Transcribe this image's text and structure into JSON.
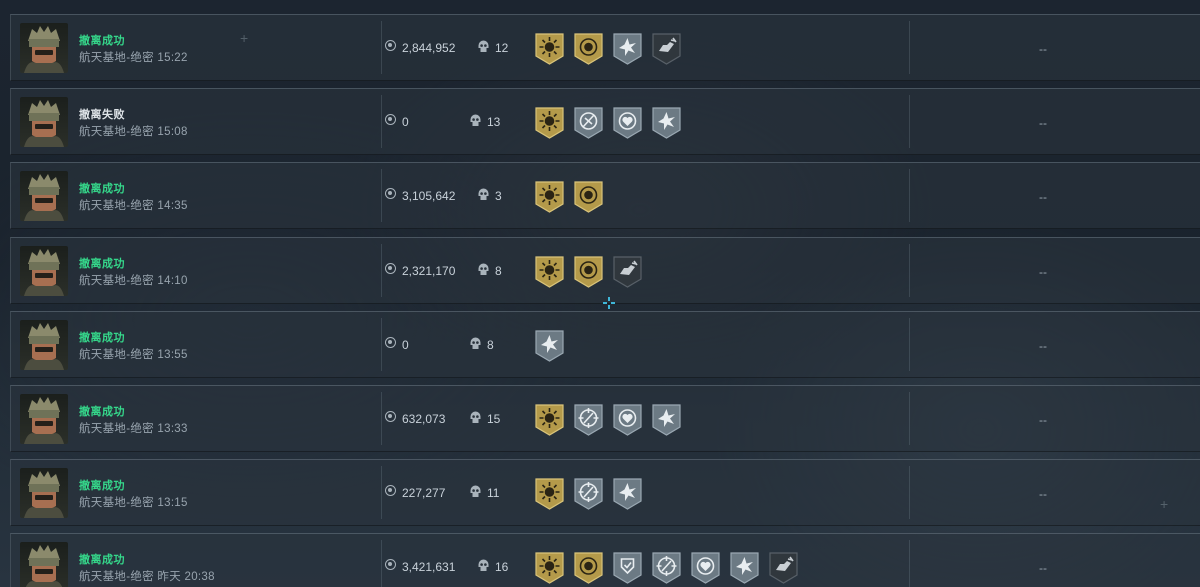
{
  "colors": {
    "success": "#35d88b",
    "fail": "#dfe4e8",
    "gold_badge": "#b49a4a",
    "silver_badge": "#6c7a84",
    "dark_badge": "#30373d"
  },
  "icons": {
    "currency": "coin-icon",
    "kills": "skull-icon",
    "badges": {
      "gold-sun": "sun-burst-gold-badge-icon",
      "gold-target": "target-circle-gold-badge-icon",
      "silver-star": "star-burst-silver-badge-icon",
      "silver-compass": "compass-circle-silver-badge-icon",
      "silver-crosshair": "crosshair-circle-silver-badge-icon",
      "silver-heart": "medic-circle-silver-badge-icon",
      "dark-hand": "hand-grab-dark-badge-icon",
      "silver-shield": "shield-check-silver-badge-icon"
    }
  },
  "matches": [
    {
      "status": "撤离成功",
      "result": "success",
      "map_time": "航天基地-绝密 15:22",
      "value": "2,844,952",
      "kills": "12",
      "badges": [
        "gold-sun",
        "gold-target",
        "silver-star",
        "dark-hand"
      ],
      "extra": "--"
    },
    {
      "status": "撤离失败",
      "result": "fail",
      "map_time": "航天基地-绝密 15:08",
      "value": "0",
      "kills": "13",
      "badges": [
        "gold-sun",
        "silver-compass",
        "silver-heart",
        "silver-star"
      ],
      "extra": "--"
    },
    {
      "status": "撤离成功",
      "result": "success",
      "map_time": "航天基地-绝密 14:35",
      "value": "3,105,642",
      "kills": "3",
      "badges": [
        "gold-sun",
        "gold-target"
      ],
      "extra": "--"
    },
    {
      "status": "撤离成功",
      "result": "success",
      "map_time": "航天基地-绝密 14:10",
      "value": "2,321,170",
      "kills": "8",
      "badges": [
        "gold-sun",
        "gold-target",
        "dark-hand"
      ],
      "extra": "--"
    },
    {
      "status": "撤离成功",
      "result": "success",
      "map_time": "航天基地-绝密 13:55",
      "value": "0",
      "kills": "8",
      "badges": [
        "silver-star"
      ],
      "extra": "--"
    },
    {
      "status": "撤离成功",
      "result": "success",
      "map_time": "航天基地-绝密 13:33",
      "value": "632,073",
      "kills": "15",
      "badges": [
        "gold-sun",
        "silver-crosshair",
        "silver-heart",
        "silver-star"
      ],
      "extra": "--"
    },
    {
      "status": "撤离成功",
      "result": "success",
      "map_time": "航天基地-绝密 13:15",
      "value": "227,277",
      "kills": "11",
      "badges": [
        "gold-sun",
        "silver-crosshair",
        "silver-star"
      ],
      "extra": "--"
    },
    {
      "status": "撤离成功",
      "result": "success",
      "map_time": "航天基地-绝密 昨天 20:38",
      "value": "3,421,631",
      "kills": "16",
      "badges": [
        "gold-sun",
        "gold-target",
        "silver-shield",
        "silver-crosshair",
        "silver-heart",
        "silver-star",
        "dark-hand"
      ],
      "extra": "--"
    }
  ]
}
